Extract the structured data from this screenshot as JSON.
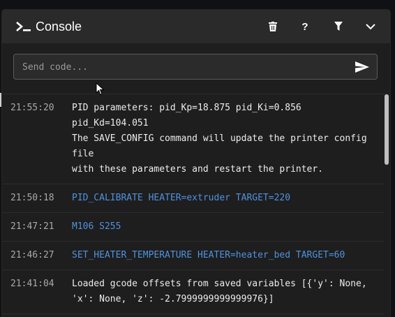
{
  "header": {
    "title": "Console",
    "buttons": [
      {
        "name": "trash-icon",
        "glyph": "🗑"
      },
      {
        "name": "help-icon",
        "glyph": "?"
      },
      {
        "name": "filter-icon",
        "glyph": "⏷"
      },
      {
        "name": "chevron-down-icon",
        "glyph": "⌄"
      }
    ]
  },
  "input": {
    "placeholder": "Send code...",
    "value": ""
  },
  "entries": [
    {
      "time": "21:55:20",
      "type": "response",
      "message": "PID parameters: pid_Kp=18.875 pid_Ki=0.856 pid_Kd=104.051\nThe SAVE_CONFIG command will update the printer config file\nwith these parameters and restart the printer."
    },
    {
      "time": "21:50:18",
      "type": "command",
      "message": "PID_CALIBRATE HEATER=extruder TARGET=220"
    },
    {
      "time": "21:47:21",
      "type": "command",
      "message": "M106 S255"
    },
    {
      "time": "21:46:27",
      "type": "command",
      "message": "SET_HEATER_TEMPERATURE HEATER=heater_bed TARGET=60"
    },
    {
      "time": "21:41:04",
      "type": "response",
      "message": "Loaded gcode offsets from saved variables [{'y': None, 'x': None, 'z': -2.7999999999999976}]"
    }
  ],
  "colors": {
    "panel": "#1e1e1e",
    "header": "#2a2a2a",
    "command_text": "#4f92df",
    "response_text": "#ececec",
    "timestamp_text": "#a9a9a9"
  }
}
